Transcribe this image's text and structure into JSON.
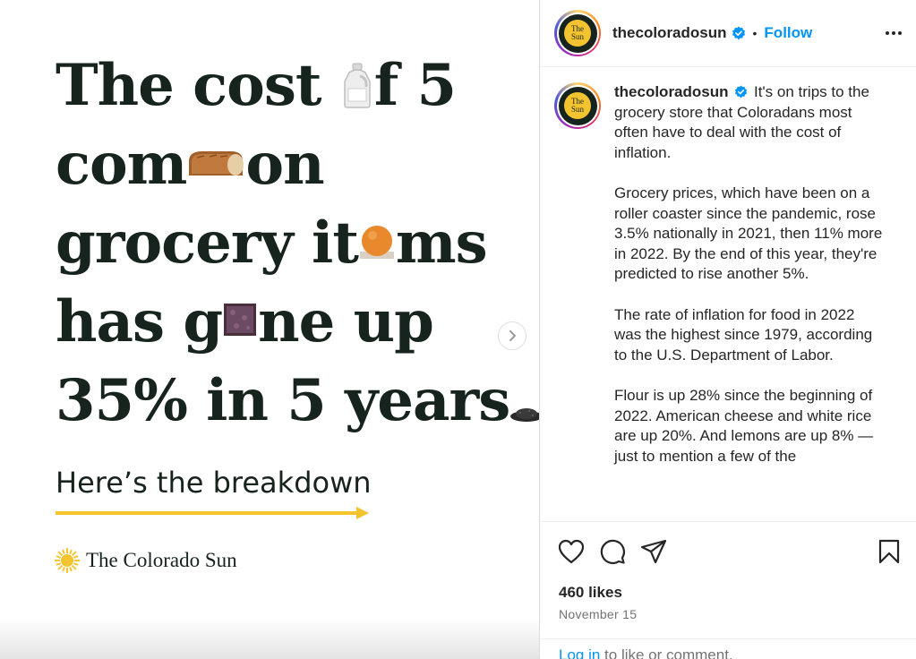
{
  "post_image": {
    "headline": {
      "line1_a": "The cost ",
      "line1_b": "f 5",
      "line2_a": "com",
      "line2_b": "on",
      "line3_a": "grocery it",
      "line3_b": "ms",
      "line4_a": "has g",
      "line4_b": "ne up",
      "line5": "35% in 5 years"
    },
    "breakdown": "Here’s the breakdown",
    "brand_name": "The Colorado Sun",
    "accent_color": "#f4c430",
    "text_color": "#17231d"
  },
  "header": {
    "avatar_text": "The Sun",
    "username": "thecoloradosun",
    "separator": "•",
    "follow_label": "Follow"
  },
  "caption": {
    "username": "thecoloradosun",
    "p1": "It's on trips to the grocery store that Coloradans most often have to deal with the cost of inflation.",
    "p2": "Grocery prices, which have been on a roller coaster since the pandemic, rose 3.5% nationally in 2021, then 11% more in 2022. By the end of this year, they're predicted to rise another 5%.",
    "p3": "The rate of inflation for food in 2022 was the highest since 1979, according to the U.S. Department of Labor.",
    "p4": "Flour is up 28% since the beginning of 2022. American cheese and white rice are up 20%. And lemons are up 8% — just to mention a few of the"
  },
  "stats": {
    "likes": "460 likes",
    "date": "November 15"
  },
  "login": {
    "link": "Log in",
    "rest": " to like or comment."
  },
  "colors": {
    "link_blue": "#0095f6",
    "verified_blue": "#0095f6",
    "muted": "#737373"
  }
}
